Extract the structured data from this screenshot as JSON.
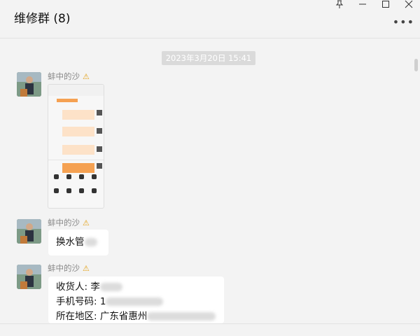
{
  "header": {
    "title": "维修群 (8)",
    "more_icon": "more-dots-icon",
    "pin_icon": "pin-icon",
    "minimize_icon": "minimize-icon",
    "maximize_icon": "maximize-icon",
    "close_icon": "close-icon"
  },
  "chat": {
    "timestamp": "2023年3月20日 15:41",
    "messages": [
      {
        "sender": "蚌中的沙",
        "type": "image"
      },
      {
        "sender": "蚌中的沙",
        "type": "text",
        "text": "换水管"
      },
      {
        "sender": "蚌中的沙",
        "type": "text",
        "lines": [
          "收货人: 李",
          "手机号码: 1",
          "所在地区: 广东省惠州"
        ]
      }
    ]
  },
  "colors": {
    "warning": "#e3a21a",
    "accent": "#f5a152"
  }
}
